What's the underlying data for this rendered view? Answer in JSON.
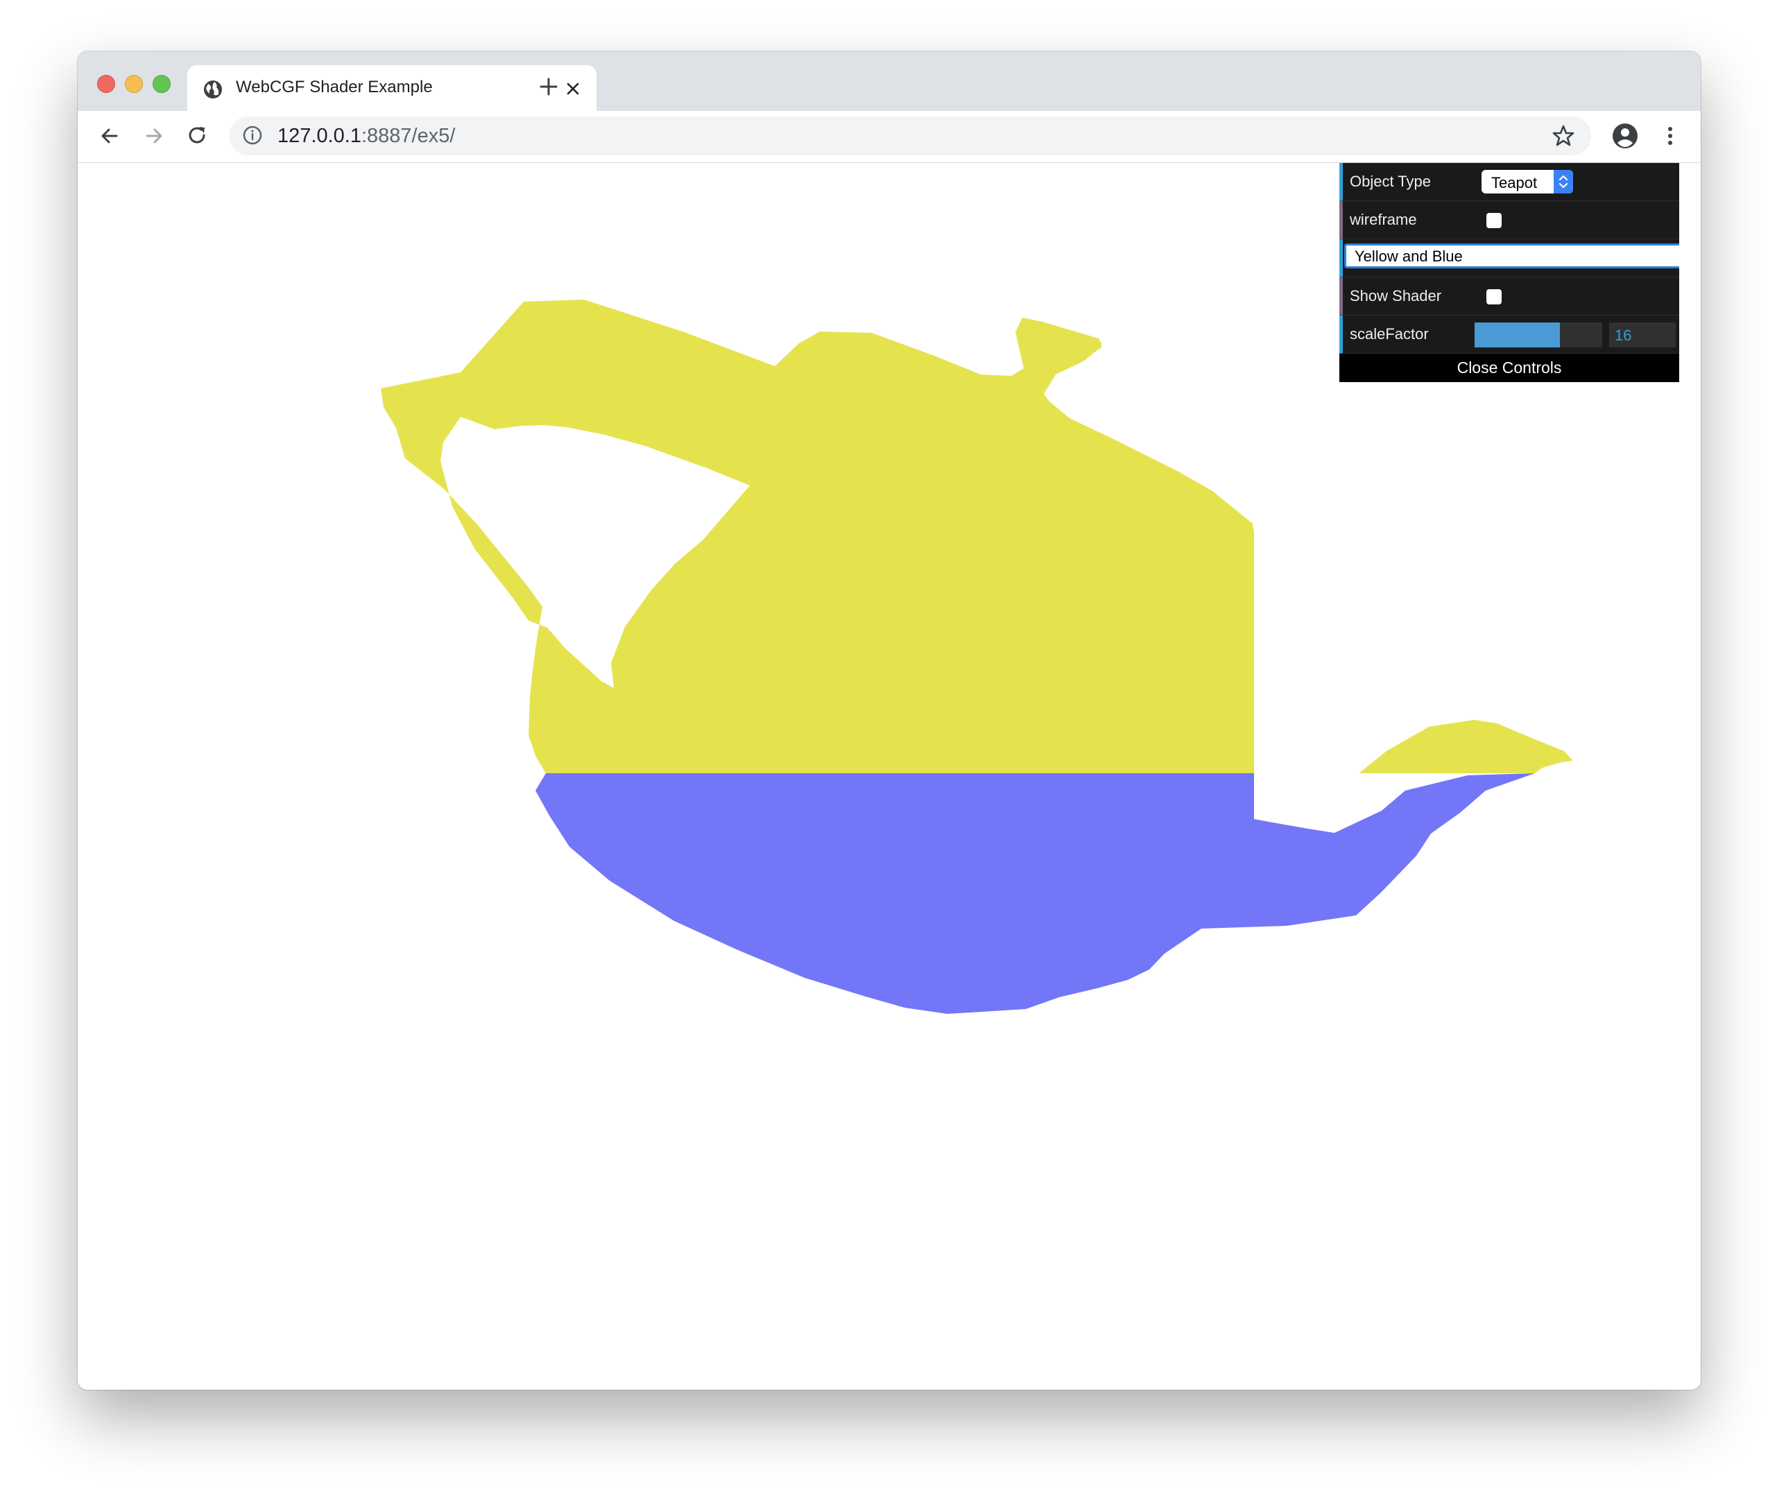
{
  "browser": {
    "tab_title": "WebCGF Shader Example",
    "url_host": "127.0.0.1",
    "url_path": ":8887/ex5/"
  },
  "gui": {
    "object_type_label": "Object Type",
    "object_type_value": "Teapot",
    "wireframe_label": "wireframe",
    "wireframe_checked": false,
    "shader_value": "Yellow and Blue",
    "show_shader_label": "Show Shader",
    "show_shader_checked": false,
    "scale_factor_label": "scaleFactor",
    "scale_factor_value": "16",
    "scale_factor_fraction": 0.67,
    "close_label": "Close Controls"
  },
  "scene": {
    "object": "teapot",
    "top_color": "#e5e34d",
    "bottom_color": "#7276f7"
  }
}
